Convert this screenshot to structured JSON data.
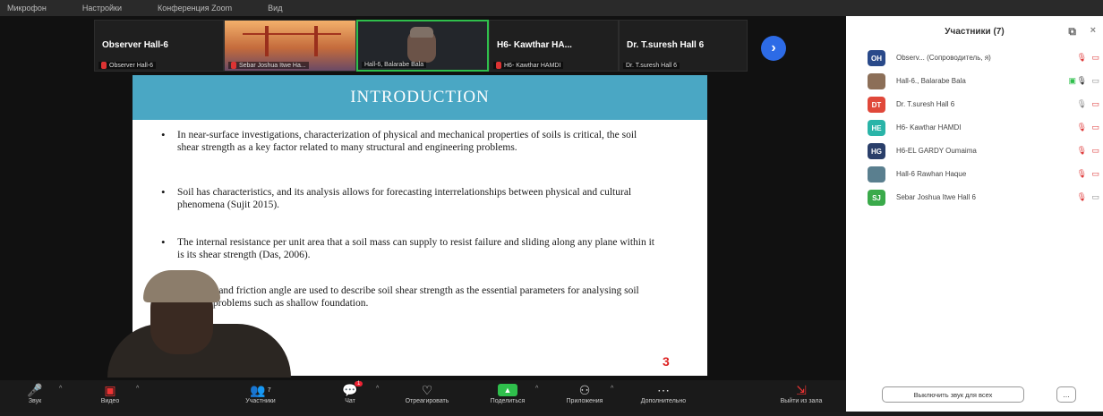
{
  "top_bar": [
    "Микрофон",
    "Настройки",
    "Конференция Zoom",
    "Вид"
  ],
  "thumbnails": [
    {
      "name": "Observer Hall-6",
      "caption": "Observer Hall-6"
    },
    {
      "name": "",
      "caption": "Sebar Joshua Itwe Ha..."
    },
    {
      "name": "",
      "caption": "Hall-6, Balarabe Bala"
    },
    {
      "name": "H6- Kawthar HA...",
      "caption": "H6- Kawthar HAMDI"
    },
    {
      "name": "Dr. T.suresh Hall 6",
      "caption": "Dr. T.suresh Hall 6"
    }
  ],
  "slide": {
    "title": "INTRODUCTION",
    "bullets": [
      "In near-surface investigations, characterization of physical and mechanical properties of soils is critical, the soil shear strength as a key factor related to many structural and engineering problems.",
      "Soil has characteristics, and its analysis allows for forecasting interrelationships between physical and cultural phenomena (Sujit 2015).",
      "The internal resistance per unit area that a soil mass can supply to resist failure and sliding along any plane within it is its shear strength (Das, 2006).",
      "Cohesion and friction angle are used to describe soil shear strength as the essential parameters for analysing soil stability problems such as shallow foundation."
    ],
    "page": "3"
  },
  "toolbar": {
    "audio": "Звук",
    "video": "Видео",
    "participants": "Участники",
    "participants_count": "7",
    "chat": "Чат",
    "chat_badge": "1",
    "react": "Отреагировать",
    "share": "Поделиться",
    "apps": "Приложения",
    "more": "Дополнительно",
    "leave": "Выйти из зала"
  },
  "panel": {
    "title": "Участники (7)",
    "participants": [
      {
        "initials": "OH",
        "name": "Observ... (Сопроводитель, я)",
        "color": "#2a4a8a"
      },
      {
        "initials": "",
        "name": "Hall-6., Balarabe Bala",
        "color": "#8c6f58"
      },
      {
        "initials": "DT",
        "name": "Dr. T.suresh Hall 6",
        "color": "#e0483a"
      },
      {
        "initials": "HE",
        "name": "H6- Kawthar HAMDI",
        "color": "#2ab4a8"
      },
      {
        "initials": "HG",
        "name": "H6-EL GARDY Oumaima",
        "color": "#2a3f6a"
      },
      {
        "initials": "",
        "name": "Hall-6 Rawhan Haque",
        "color": "#5a7f8f"
      },
      {
        "initials": "SJ",
        "name": "Sebar Joshua Itwe Hall 6",
        "color": "#3aaa4a"
      }
    ],
    "mute_all": "Выключить звук для всех",
    "more": "..."
  }
}
